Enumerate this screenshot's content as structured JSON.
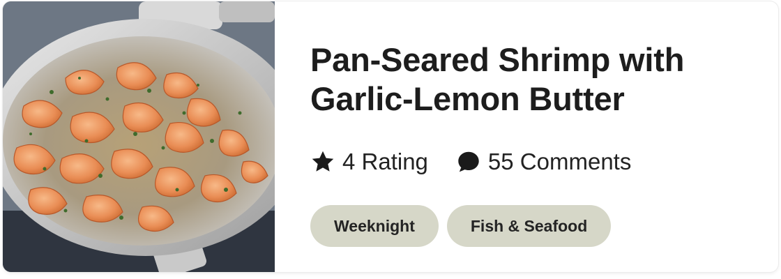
{
  "recipe": {
    "title_lines": [
      "Pan-Seared Shrimp with",
      "Garlic-Lemon Butter"
    ],
    "rating_label": "4 Rating",
    "comments_label": "55 Comments",
    "tags": [
      "Weeknight",
      "Fish & Seafood"
    ]
  },
  "icons": {
    "rating": "star-icon",
    "comments": "speech-bubble-icon"
  },
  "colors": {
    "tag_background": "#d6d7c8",
    "text": "#1d1d1d",
    "icon": "#1a1a1a"
  }
}
